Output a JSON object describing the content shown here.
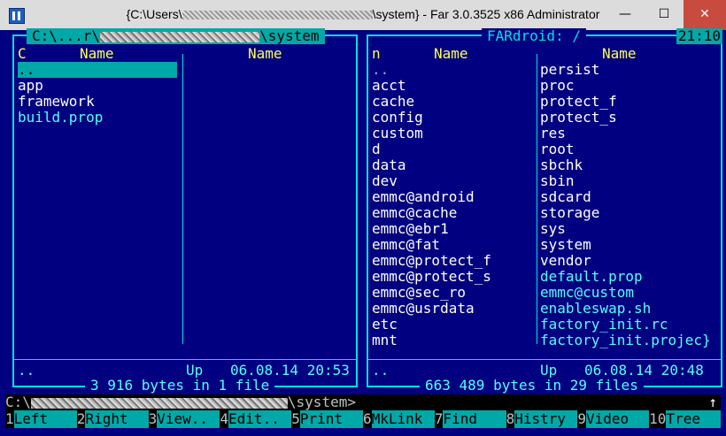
{
  "window": {
    "title_prefix": "{C:\\Users\\",
    "title_suffix": "\\system} - Far 3.0.3525 x86 Administrator",
    "min": "—",
    "max": "☐",
    "close": "✕"
  },
  "left_panel": {
    "title_prefix": "C:\\...r\\",
    "title_suffix": "\\system",
    "header_c": "C",
    "header_name1": "Name",
    "header_name2": "Name",
    "files": [
      {
        "name": "..",
        "style": "selected"
      },
      {
        "name": "app",
        "style": "dir"
      },
      {
        "name": "framework",
        "style": "dir"
      },
      {
        "name": "build.prop",
        "style": "file"
      }
    ],
    "footer_name": "..",
    "footer_up": "Up",
    "footer_date": "06.08.14 20:53",
    "summary": "3 916 bytes in 1 file"
  },
  "right_panel": {
    "title": "FARdroid: /",
    "clock": "21:10",
    "header_n": "n",
    "header_name1": "Name",
    "header_name2": "Name",
    "col1": [
      {
        "name": "..",
        "style": "up"
      },
      {
        "name": "acct",
        "style": "dir"
      },
      {
        "name": "cache",
        "style": "dir"
      },
      {
        "name": "config",
        "style": "dir"
      },
      {
        "name": "custom",
        "style": "dir"
      },
      {
        "name": "d",
        "style": "dir"
      },
      {
        "name": "data",
        "style": "dir"
      },
      {
        "name": "dev",
        "style": "dir"
      },
      {
        "name": "emmc@android",
        "style": "dir"
      },
      {
        "name": "emmc@cache",
        "style": "dir"
      },
      {
        "name": "emmc@ebr1",
        "style": "dir"
      },
      {
        "name": "emmc@fat",
        "style": "dir"
      },
      {
        "name": "emmc@protect_f",
        "style": "dir"
      },
      {
        "name": "emmc@protect_s",
        "style": "dir"
      },
      {
        "name": "emmc@sec_ro",
        "style": "dir"
      },
      {
        "name": "emmc@usrdata",
        "style": "dir"
      },
      {
        "name": "etc",
        "style": "dir"
      },
      {
        "name": "mnt",
        "style": "dir"
      }
    ],
    "col2": [
      {
        "name": "persist",
        "style": "dir"
      },
      {
        "name": "proc",
        "style": "dir"
      },
      {
        "name": "protect_f",
        "style": "dir"
      },
      {
        "name": "protect_s",
        "style": "dir"
      },
      {
        "name": "res",
        "style": "dir"
      },
      {
        "name": "root",
        "style": "dir"
      },
      {
        "name": "sbchk",
        "style": "dir"
      },
      {
        "name": "sbin",
        "style": "dir"
      },
      {
        "name": "sdcard",
        "style": "dir"
      },
      {
        "name": "storage",
        "style": "dir"
      },
      {
        "name": "sys",
        "style": "dir"
      },
      {
        "name": "system",
        "style": "dir"
      },
      {
        "name": "vendor",
        "style": "dir"
      },
      {
        "name": "default.prop",
        "style": "file"
      },
      {
        "name": "emmc@custom",
        "style": "file"
      },
      {
        "name": "enableswap.sh",
        "style": "file"
      },
      {
        "name": "factory_init.rc",
        "style": "file"
      },
      {
        "name": "factory_init.projec}",
        "style": "file"
      }
    ],
    "footer_name": "..",
    "footer_up": "Up",
    "footer_date": "06.08.14 20:48",
    "summary": "663 489 bytes in 29 files"
  },
  "command_line": {
    "prefix": "C:\\",
    "suffix": "\\system>",
    "arrow": "↑"
  },
  "keybar": [
    {
      "num": "1",
      "label": "Left"
    },
    {
      "num": "2",
      "label": "Right"
    },
    {
      "num": "3",
      "label": "View.."
    },
    {
      "num": "4",
      "label": "Edit.."
    },
    {
      "num": "5",
      "label": "Print"
    },
    {
      "num": "6",
      "label": "MkLink"
    },
    {
      "num": "7",
      "label": "Find"
    },
    {
      "num": "8",
      "label": "Histry"
    },
    {
      "num": "9",
      "label": "Video"
    },
    {
      "num": "10",
      "label": "Tree"
    }
  ],
  "colors": {
    "background": "#000080",
    "border": "#00e0e0",
    "header": "#ffff55",
    "directory": "#ffffff",
    "file": "#55ffff",
    "selection": "#00a8a8"
  }
}
